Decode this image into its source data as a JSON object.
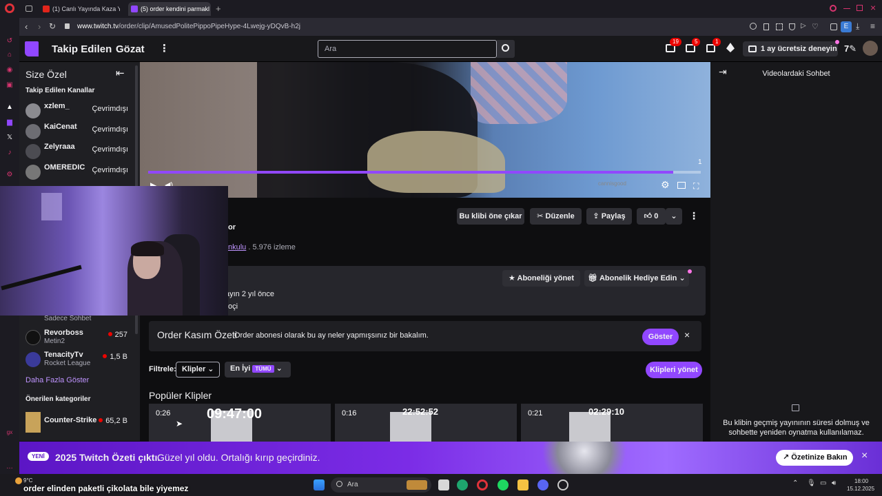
{
  "browser": {
    "tabs": [
      {
        "label": "(1) Canlı Yayında Kaza Ya"
      },
      {
        "label": "(5) order kendini parmakl"
      }
    ],
    "url_prefix": "www.twitch.tv",
    "url_path": "/order/clip/AmusedPolitePippoPipeHype-4Lwejg-yDQvB-h2j"
  },
  "topnav": {
    "following": "Takip Edilen",
    "browse": "Gözat",
    "search_placeholder": "Ara",
    "badges": [
      "19",
      "5",
      "1"
    ],
    "free_trial": "1 ay ücretsiz deneyin"
  },
  "sidebar": {
    "title": "Size Özel",
    "followed_header": "Takip Edilen Kanallar",
    "followed": [
      {
        "name": "xzlem_",
        "status": "Çevrimdışı"
      },
      {
        "name": "KaiCenat",
        "status": "Çevrimdışı"
      },
      {
        "name": "Zelyraaa",
        "status": "Çevrimdışı"
      },
      {
        "name": "OMEREDIC",
        "status": "Çevrimdışı"
      }
    ],
    "partial_game": "Sadece Sohbet",
    "live": [
      {
        "name": "Revorboss",
        "game": "Metin2",
        "viewers": "257"
      },
      {
        "name": "TenacityTv",
        "game": "Rocket League",
        "viewers": "1,5 B"
      }
    ],
    "show_more": "Daha Fazla Göster",
    "recommended_header": "Önerilen kategoriler",
    "categories": [
      {
        "name": "Counter-Strike",
        "viewers": "65,2 B"
      }
    ]
  },
  "video": {
    "progress": 0.95,
    "counter": "1",
    "watermark": "cannisgood"
  },
  "clip_info": {
    "title_fragment": "or",
    "channel_fragment": "nkulu",
    "views": ". 5.976 izleme",
    "actions": {
      "feature": "Bu klibi öne çıkar",
      "edit": "Düzenle",
      "share": "Paylaş",
      "likes": "0"
    }
  },
  "subscription": {
    "manage": "Aboneliği yönet",
    "gift": "Abonelik Hediye Edin",
    "line1": "ayın 2 yıl önce",
    "line2": "oçi"
  },
  "recap": {
    "title": "Order Kasım Özeti",
    "text": "Order abonesi olarak bu ay neler yapmışsınız bir bakalım.",
    "button": "Göster"
  },
  "filters": {
    "label": "Filtrele:",
    "clips": "Klipler",
    "best": "En İyi",
    "all_tag": "TÜMÜ",
    "manage": "Klipleri yönet"
  },
  "popular": {
    "title": "Popüler Klipler",
    "clips": [
      {
        "duration": "0:26",
        "overlay": "09:47:00"
      },
      {
        "duration": "0:16",
        "overlay": "22:52:52"
      },
      {
        "duration": "0:21",
        "overlay": "02:29:10"
      }
    ]
  },
  "chat": {
    "title": "Videolardaki Sohbet",
    "message": "Bu klibin geçmiş yayınının süresi dolmuş ve sohbette yeniden oynatma kullanılamaz."
  },
  "banner": {
    "new": "YENİ",
    "headline": "2025 Twitch Özeti çıktı.",
    "sub": "Güzel yıl oldu. Ortalığı kırıp geçirdiniz.",
    "button": "Özetinize Bakın"
  },
  "taskbar": {
    "weather": "9°C",
    "search": "Ara",
    "time": "18:00",
    "date": "15.12.2025"
  },
  "subtitle": "order elinden paketli çikolata bile yiyemez",
  "colors": {
    "accent": "#9147ff",
    "live": "#eb0400",
    "bg": "#0e0e10"
  }
}
